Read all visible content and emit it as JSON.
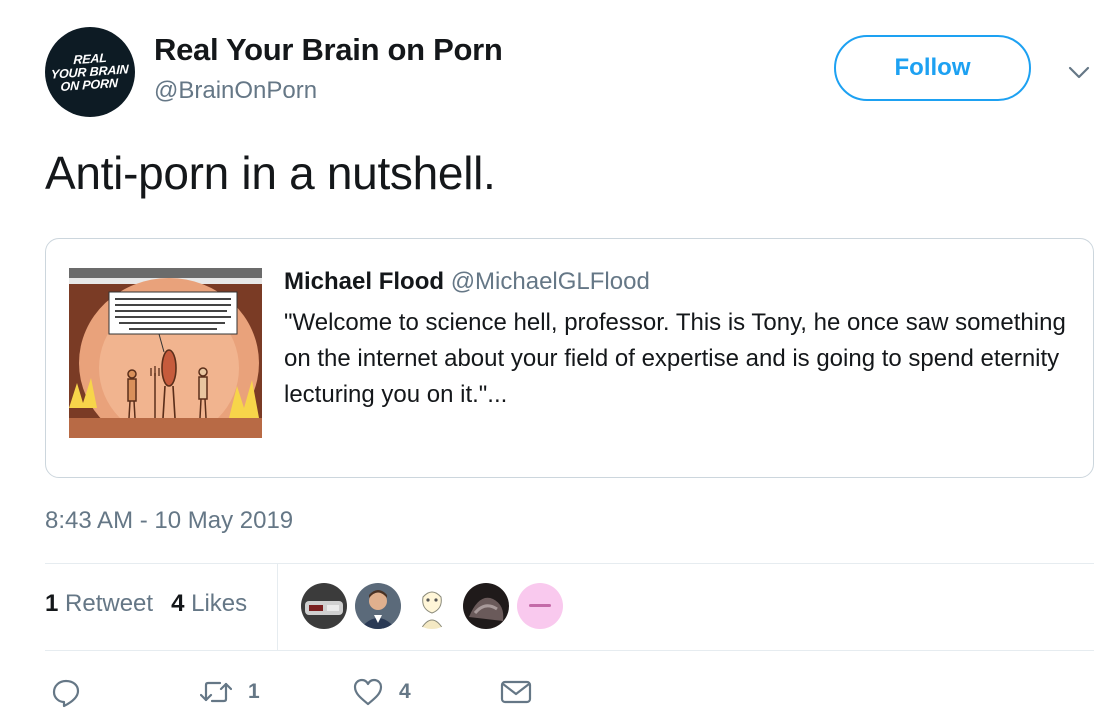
{
  "author": {
    "avatar_text": "REAL\nYOUR BRAIN\nON PORN",
    "display_name": "Real Your Brain on Porn",
    "handle": "@BrainOnPorn"
  },
  "follow_label": "Follow",
  "tweet_text": "Anti-porn in a nutshell.",
  "quoted_tweet": {
    "author_name": "Michael Flood",
    "author_handle": "@MichaelGLFlood",
    "text": "\"Welcome to science hell, professor. This is Tony, he once saw something on the internet about your field of expertise and is going to spend eternity lecturing you on it.\"...",
    "image_caption": "WELCOME TO SCIENCE HELL, PROFESSOR. THIS IS TONY. HE ONCE SAW SOMETHING ON THE INTERNET ABOUT YOUR FIELD OF EXPERTISE AND IS GOING TO SPEND ETERNITY LECTURING YOU ON IT."
  },
  "timestamp": "8:43 AM - 10 May 2019",
  "stats": {
    "retweets_count": "1",
    "retweets_label": "Retweet",
    "likes_count": "4",
    "likes_label": "Likes"
  },
  "likers": [
    {
      "icon": "liker-avatar-1"
    },
    {
      "icon": "liker-avatar-2"
    },
    {
      "icon": "liker-avatar-3"
    },
    {
      "icon": "liker-avatar-4"
    },
    {
      "icon": "liker-avatar-5"
    }
  ],
  "actions": {
    "reply_icon": "reply-icon",
    "retweet_icon": "retweet-icon",
    "retweet_count": "1",
    "like_icon": "heart-icon",
    "like_count": "4",
    "dm_icon": "envelope-icon"
  },
  "colors": {
    "accent": "#1da1f2",
    "text_primary": "#14171a",
    "text_secondary": "#657786",
    "border": "#ccd6dd"
  }
}
